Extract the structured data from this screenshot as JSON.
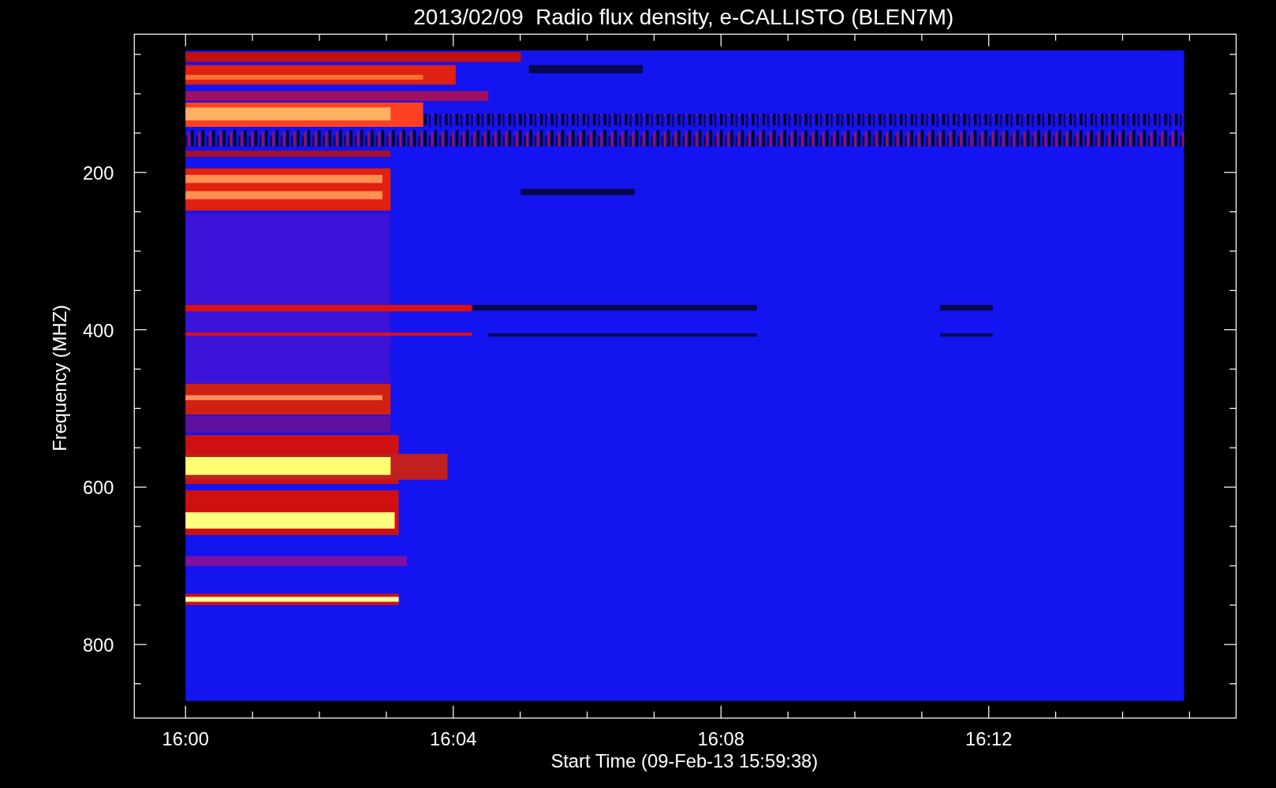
{
  "plot": {
    "title": "2013/02/09  Radio flux density, e-CALLISTO (BLEN7M)",
    "ylabel": "Frequency (MHZ)",
    "xlabel": "Start Time (09-Feb-13 15:59:38)",
    "yticks": [
      "200",
      "400",
      "600",
      "800"
    ],
    "xticks": [
      "16:00",
      "16:04",
      "16:08",
      "16:12"
    ]
  }
}
